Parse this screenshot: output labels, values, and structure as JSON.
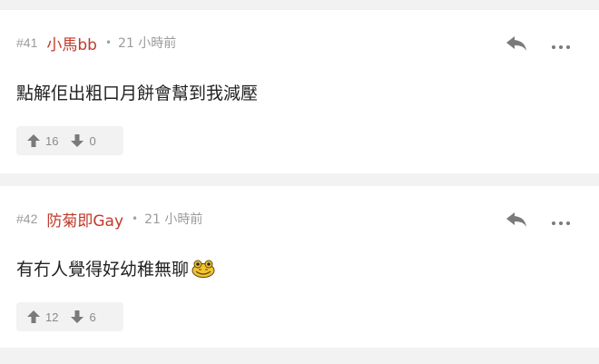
{
  "posts": [
    {
      "number": "#41",
      "username": "小馬bb",
      "timestamp": "21 小時前",
      "content": "點解佢出粗口月餅會幫到我減壓",
      "upvotes": "16",
      "downvotes": "0",
      "emoji": null
    },
    {
      "number": "#42",
      "username": "防菊即Gay",
      "timestamp": "21 小時前",
      "content": "有冇人覺得好幼稚無聊",
      "upvotes": "12",
      "downvotes": "6",
      "emoji": "frog-face-emoji"
    }
  ],
  "icons": {
    "separator": "•",
    "reply": "reply-icon",
    "more": "more-icon",
    "upvote": "arrow-up-icon",
    "downvote": "arrow-down-icon"
  },
  "colors": {
    "username": "#c0392b",
    "meta_text": "#9b9b9b",
    "icon": "#7a7a7a",
    "background": "#f2f2f2",
    "card": "#ffffff"
  }
}
